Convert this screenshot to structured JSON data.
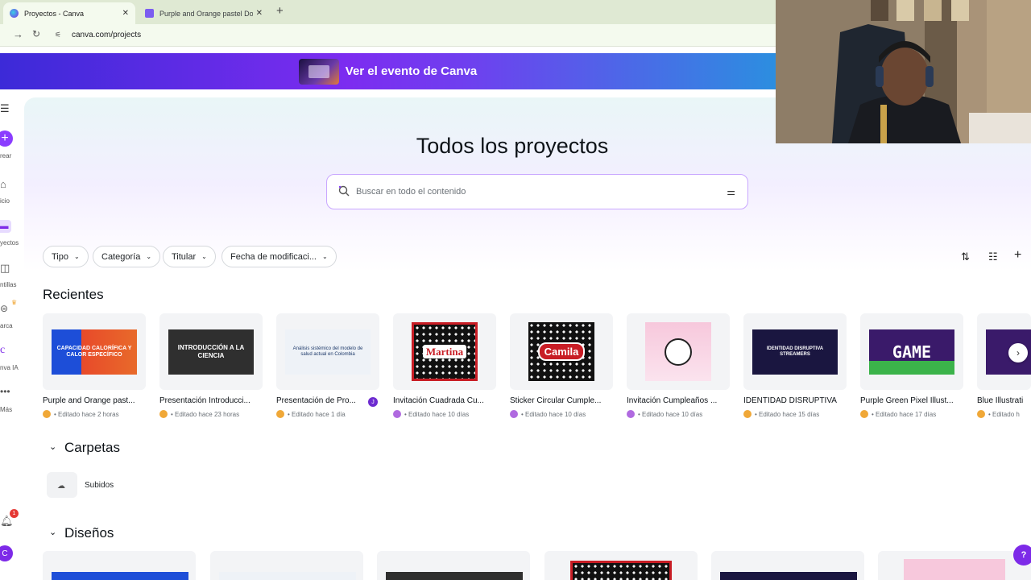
{
  "browser": {
    "tabs": [
      {
        "title": "Proyectos - Canva",
        "close": "✕"
      },
      {
        "title": "Purple and Orange pastel Doo",
        "close": "✕"
      }
    ],
    "new_tab": "+",
    "url": "canva.com/projects"
  },
  "banner": {
    "text": "Ver el evento de Canva"
  },
  "sidebar": {
    "create": "rear",
    "home": "icio",
    "projects": "yectos",
    "templates": "ntillas",
    "brand": "arca",
    "ai": "nva IA",
    "more": "Más",
    "notifications_count": "1",
    "avatar_letter": "C"
  },
  "page": {
    "title": "Todos los proyectos",
    "search_placeholder": "Buscar en todo el contenido"
  },
  "filters": [
    "Tipo",
    "Categoría",
    "Titular",
    "Fecha de modificaci..."
  ],
  "sections": {
    "recent": "Recientes",
    "folders": "Carpetas",
    "designs": "Diseños"
  },
  "recent": [
    {
      "name": "Purple and Orange past...",
      "meta": "• Editado hace 2 horas",
      "thumb_text": "CAPACIDAD CALORÍFICA Y CALOR ESPECÍFICO",
      "thumb_bg": "#e84a2a",
      "avatar": "#f0a838"
    },
    {
      "name": "Presentación Introducci...",
      "meta": "• Editado hace 23 horas",
      "thumb_text": "INTRODUCCIÓN A LA CIENCIA",
      "thumb_bg": "#2f2f2f",
      "avatar": "#f0a838"
    },
    {
      "name": "Presentación de Pro...",
      "meta": "• Editado hace 1 día",
      "thumb_text": "Análisis sistémico del modelo de salud actual en Colombia",
      "thumb_bg": "#eef2f7",
      "avatar": "#f0a838",
      "badge": "J"
    },
    {
      "name": "Invitación Cuadrada Cu...",
      "meta": "• Editado hace 10 días",
      "thumb_text": "Martina",
      "thumb_bg": "#1a1a1a",
      "avatar": "#b06ae0"
    },
    {
      "name": "Sticker Circular Cumple...",
      "meta": "• Editado hace 10 días",
      "thumb_text": "Camila",
      "thumb_bg": "#111111",
      "avatar": "#b06ae0"
    },
    {
      "name": "Invitación Cumpleaños ...",
      "meta": "• Editado hace 10 días",
      "thumb_text": "",
      "thumb_bg": "#f7c8dc",
      "avatar": "#b06ae0"
    },
    {
      "name": "IDENTIDAD DISRUPTIVA",
      "meta": "• Editado hace 15 días",
      "thumb_text": "IDENTIDAD DISRUPTIVA STREAMERS",
      "thumb_bg": "#1a1640",
      "avatar": "#f0a838"
    },
    {
      "name": "Purple Green Pixel Illust...",
      "meta": "• Editado hace 17 días",
      "thumb_text": "GAME",
      "thumb_bg": "#3a1a6a",
      "avatar": "#f0a838"
    },
    {
      "name": "Blue Illustrati",
      "meta": "• Editado h",
      "thumb_text": "",
      "thumb_bg": "#3a1a6a",
      "avatar": "#f0a838"
    }
  ],
  "folders": [
    {
      "name": "Subidos"
    }
  ],
  "help": "?"
}
